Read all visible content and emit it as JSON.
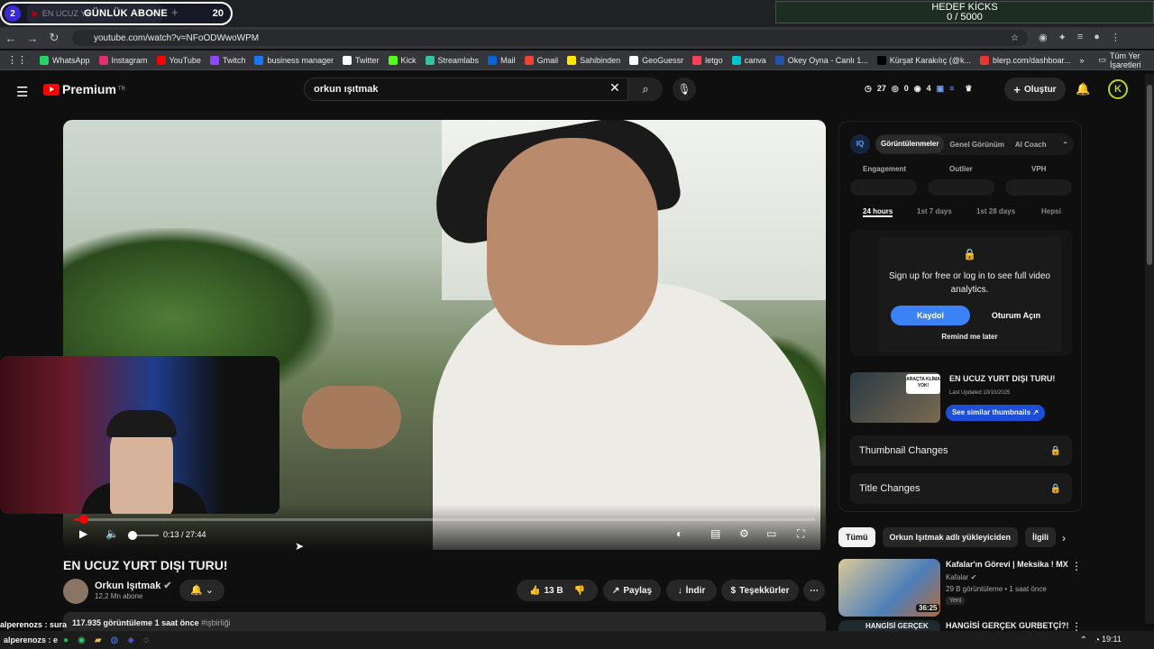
{
  "browser": {
    "tab_title": "EN UCUZ YU...",
    "tab_count": "20",
    "url": "youtube.com/watch?v=NFoODWwoWPM",
    "bookmarks": [
      {
        "label": "WhatsApp",
        "color": "#25d366"
      },
      {
        "label": "Instagram",
        "color": "#e1306c"
      },
      {
        "label": "YouTube",
        "color": "#ff0000"
      },
      {
        "label": "Twitch",
        "color": "#9146ff"
      },
      {
        "label": "business manager",
        "color": "#1877f2"
      },
      {
        "label": "Twitter",
        "color": "#ffffff"
      },
      {
        "label": "Kick",
        "color": "#53fc18"
      },
      {
        "label": "Streamlabs",
        "color": "#31c3a2"
      },
      {
        "label": "Mail",
        "color": "#0a64d6"
      },
      {
        "label": "Gmail",
        "color": "#ea4335"
      },
      {
        "label": "Sahibinden",
        "color": "#ffe800"
      },
      {
        "label": "GeoGuessr",
        "color": "#ffffff"
      },
      {
        "label": "letgo",
        "color": "#ff3f55"
      },
      {
        "label": "canva",
        "color": "#00c4cc"
      },
      {
        "label": "Okey Oyna - Canlı 1...",
        "color": "#2255aa"
      },
      {
        "label": "Kürşat Karakılıç (@k...",
        "color": "#000000"
      },
      {
        "label": "blerp.com/dashboar...",
        "color": "#e33"
      }
    ],
    "bookmarks_more": "»",
    "all_bookmarks": "Tüm Yer İşaretleri"
  },
  "stream_overlay": {
    "abone_number": "2",
    "abone_title": "GÜNLÜK ABONE",
    "abone_count": "20",
    "goal_title": "HEDEF KİCKS",
    "goal_progress": "0 / 5000",
    "chat_line_1": "alperenozs : sura",
    "chat_line_2": "alperenozs : e"
  },
  "youtube": {
    "logo": "Premium",
    "region": "TR",
    "search_value": "orkun ışıtmak",
    "header_stats": [
      "27",
      "0",
      "4"
    ],
    "create_label": "Oluştur",
    "avatar_letter": "K"
  },
  "video": {
    "time": "0:13 / 27:44",
    "progress_fraction": 0.008,
    "title": "EN UCUZ YURT DIŞI TURU!",
    "channel": "Orkun Işıtmak",
    "subscribers": "12,2 Mn abone",
    "likes": "13 B",
    "share": "Paylaş",
    "download": "İndir",
    "thanks": "Teşekkürler",
    "views": "117.935 görüntüleme",
    "uploaded": "1 saat önce",
    "hashtag": "#işbirliği"
  },
  "analytics_panel": {
    "logo": "IQ",
    "tabs": [
      "Görüntülenmeler",
      "Genel Görünüm",
      "AI Coach"
    ],
    "metrics": [
      "Engagement",
      "Outlier",
      "VPH"
    ],
    "ranges": [
      "24 hours",
      "1st 7 days",
      "1st 28 days",
      "Hepsi"
    ],
    "lock_text": "Sign up for free or log in to see full video analytics.",
    "signup": "Kaydol",
    "login": "Oturum Açın",
    "remind": "Remind me later",
    "thumb_badge": "ARAÇTA KLİMA YOK!",
    "thumb_title": "EN UCUZ YURT DIŞI TURU!",
    "thumb_date": "Last Updated 10/10/2025",
    "similar_btn": "See similar thumbnails ↗",
    "thumbnail_changes": "Thumbnail Changes",
    "title_changes": "Title Changes"
  },
  "recommendations": {
    "chips": [
      "Tümü",
      "Orkun Işıtmak adlı yükleyiciden",
      "İlgili"
    ],
    "items": [
      {
        "title": "Kafalar'ın Görevi | Meksika ! MX",
        "channel": "Kafalar",
        "meta": "29 B görüntüleme • 1 saat önce",
        "badge": "Yeni",
        "duration": "36:25"
      },
      {
        "title": "HANGİSİ GERÇEK GURBETÇİ?!",
        "thumb_text": "HANGİSİ GERÇEK"
      }
    ]
  },
  "taskbar": {
    "time": "19:11"
  }
}
